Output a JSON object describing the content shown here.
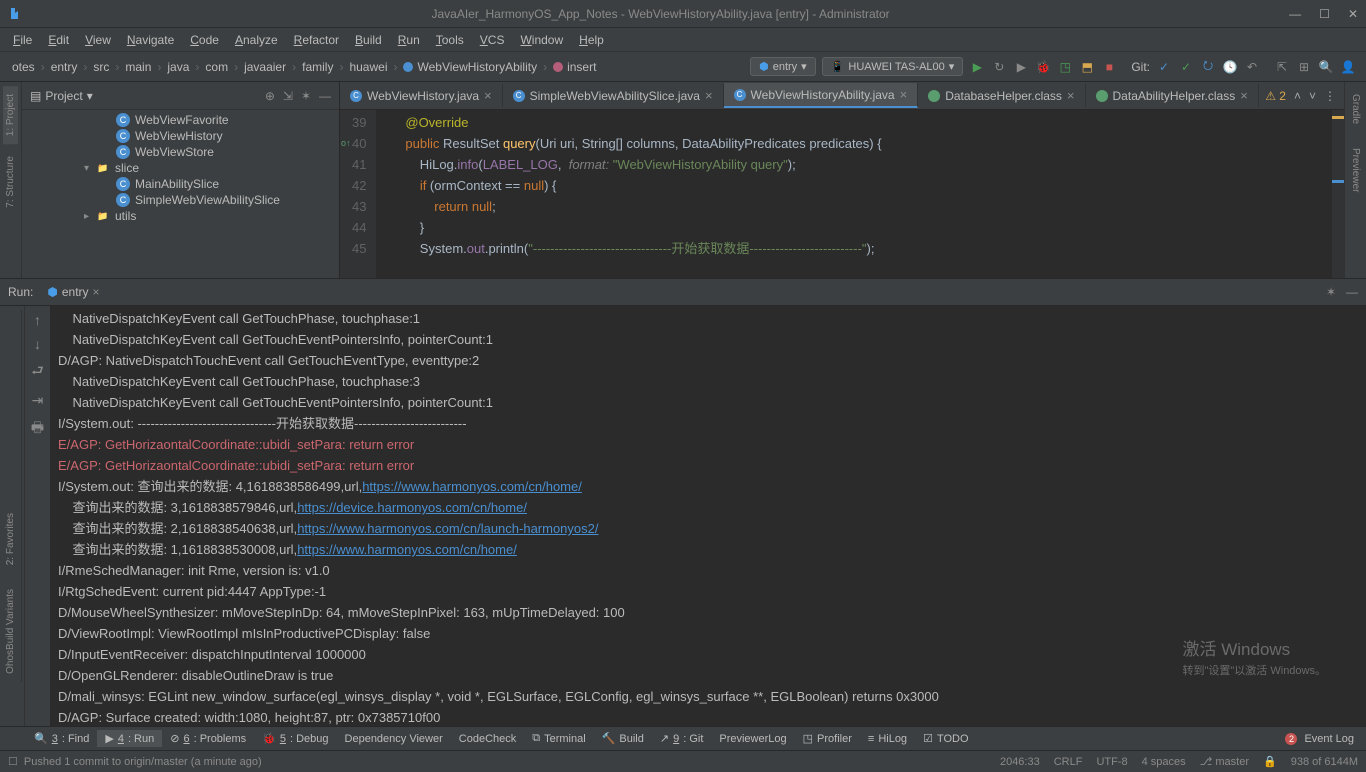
{
  "window": {
    "title": "JavaAIer_HarmonyOS_App_Notes - WebViewHistoryAbility.java [entry] - Administrator"
  },
  "menu": [
    "File",
    "Edit",
    "View",
    "Navigate",
    "Code",
    "Analyze",
    "Refactor",
    "Build",
    "Run",
    "Tools",
    "VCS",
    "Window",
    "Help"
  ],
  "breadcrumb": [
    "otes",
    "entry",
    "src",
    "main",
    "java",
    "com",
    "javaaier",
    "family",
    "huawei",
    "WebViewHistoryAbility",
    "insert"
  ],
  "toolbar": {
    "run_config": "entry",
    "device": "HUAWEI TAS-AL00",
    "git_label": "Git:"
  },
  "left_tabs": {
    "project": "1: Project",
    "structure": "7: Structure",
    "favorites": "2: Favorites",
    "build": "OhosBuild Variants"
  },
  "right_tabs": {
    "gradle": "Gradle",
    "previewer": "Previewer"
  },
  "project": {
    "header": "Project",
    "items": [
      {
        "indent": 90,
        "icon": "c",
        "label": "WebViewFavorite"
      },
      {
        "indent": 90,
        "icon": "c",
        "label": "WebViewHistory"
      },
      {
        "indent": 90,
        "icon": "c",
        "label": "WebViewStore"
      },
      {
        "indent": 58,
        "arrow": "▾",
        "icon": "folder",
        "label": "slice"
      },
      {
        "indent": 90,
        "icon": "c",
        "label": "MainAbilitySlice"
      },
      {
        "indent": 90,
        "icon": "c",
        "label": "SimpleWebViewAbilitySlice"
      },
      {
        "indent": 58,
        "arrow": "▸",
        "icon": "folder",
        "label": "utils"
      }
    ]
  },
  "editor_tabs": [
    {
      "icon": "c",
      "label": "WebViewHistory.java",
      "active": false
    },
    {
      "icon": "c",
      "label": "SimpleWebViewAbilitySlice.java",
      "active": false
    },
    {
      "icon": "c",
      "label": "WebViewHistoryAbility.java",
      "active": true
    },
    {
      "icon": "db",
      "label": "DatabaseHelper.class",
      "active": false
    },
    {
      "icon": "db",
      "label": "DataAbilityHelper.class",
      "active": false
    }
  ],
  "editor": {
    "warn_count": "2",
    "lines": [
      {
        "n": 39,
        "html": "        <span class='anno'>@Override</span>"
      },
      {
        "n": 40,
        "override": true,
        "html": "        <span class='kw'>public</span> <span class='cls'>ResultSet</span> <span class='mtd'>query</span>(Uri uri, String[] columns, DataAbilityPredicates predicates) {"
      },
      {
        "n": 41,
        "html": "            HiLog.<span class='fld'>info</span>(<span class='fld'>LABEL_LOG</span>,  <span class='com'>format:</span> <span class='str'>\"WebViewHistoryAbility query\"</span>);"
      },
      {
        "n": 42,
        "html": "            <span class='kw'>if</span> (ormContext == <span class='kw'>null</span>) {"
      },
      {
        "n": 43,
        "html": "                <span class='kw'>return null</span>;"
      },
      {
        "n": 44,
        "html": "            }"
      },
      {
        "n": 45,
        "html": "            System.<span class='fld'>out</span>.println(<span class='str'>\"--------------------------------开始获取数据--------------------------\"</span>);"
      }
    ]
  },
  "run": {
    "label": "Run:",
    "tab": "entry",
    "console_lines": [
      {
        "cls": "",
        "html": "    NativeDispatchKeyEvent call GetTouchPhase, touchphase:1"
      },
      {
        "cls": "",
        "html": "    NativeDispatchKeyEvent call GetTouchEventPointersInfo, pointerCount:1"
      },
      {
        "cls": "",
        "html": "D/AGP: NativeDispatchTouchEvent call GetTouchEventType, eventtype:2"
      },
      {
        "cls": "",
        "html": "    NativeDispatchKeyEvent call GetTouchPhase, touchphase:3"
      },
      {
        "cls": "",
        "html": "    NativeDispatchKeyEvent call GetTouchEventPointersInfo, pointerCount:1"
      },
      {
        "cls": "",
        "html": "I/System.out: --------------------------------开始获取数据--------------------------"
      },
      {
        "cls": "err",
        "html": "E/AGP: GetHorizaontalCoordinate::ubidi_setPara: return error"
      },
      {
        "cls": "err",
        "html": "E/AGP: GetHorizaontalCoordinate::ubidi_setPara: return error"
      },
      {
        "cls": "",
        "html": "I/System.out: 查询出来的数据: 4,1618838586499,url,<a href='#'>https://www.harmonyos.com/cn/home/</a>"
      },
      {
        "cls": "",
        "html": "    查询出来的数据: 3,1618838579846,url,<a href='#'>https://device.harmonyos.com/cn/home/</a>"
      },
      {
        "cls": "",
        "html": "    查询出来的数据: 2,1618838540638,url,<a href='#'>https://www.harmonyos.com/cn/launch-harmonyos2/</a>"
      },
      {
        "cls": "",
        "html": "    查询出来的数据: 1,1618838530008,url,<a href='#'>https://www.harmonyos.com/cn/home/</a>"
      },
      {
        "cls": "",
        "html": "I/RmeSchedManager: init Rme, version is: v1.0"
      },
      {
        "cls": "",
        "html": "I/RtgSchedEvent: current pid:4447 AppType:-1"
      },
      {
        "cls": "",
        "html": "D/MouseWheelSynthesizer: mMoveStepInDp: 64, mMoveStepInPixel: 163, mUpTimeDelayed: 100"
      },
      {
        "cls": "",
        "html": "D/ViewRootImpl: ViewRootImpl mIsInProductivePCDisplay: false"
      },
      {
        "cls": "",
        "html": "D/InputEventReceiver: dispatchInputInterval 1000000"
      },
      {
        "cls": "",
        "html": "D/OpenGLRenderer: disableOutlineDraw is true"
      },
      {
        "cls": "",
        "html": "D/mali_winsys: EGLint new_window_surface(egl_winsys_display *, void *, EGLSurface, EGLConfig, egl_winsys_surface **, EGLBoolean) returns 0x3000"
      },
      {
        "cls": "",
        "html": "D/AGP: Surface created: width:1080, height:87, ptr: 0x7385710f00"
      }
    ]
  },
  "bottom_tabs": [
    {
      "icon": "🔍",
      "num": "3",
      "label": ": Find"
    },
    {
      "icon": "▶",
      "num": "4",
      "label": ": Run",
      "active": true
    },
    {
      "icon": "⊘",
      "num": "6",
      "label": ": Problems"
    },
    {
      "icon": "🐞",
      "num": "5",
      "label": ": Debug"
    },
    {
      "icon": "",
      "num": "",
      "label": "Dependency Viewer"
    },
    {
      "icon": "",
      "num": "",
      "label": "CodeCheck"
    },
    {
      "icon": "⧉",
      "num": "",
      "label": "Terminal"
    },
    {
      "icon": "🔨",
      "num": "",
      "label": "Build"
    },
    {
      "icon": "↗",
      "num": "9",
      "label": ": Git"
    },
    {
      "icon": "",
      "num": "",
      "label": "PreviewerLog"
    },
    {
      "icon": "◳",
      "num": "",
      "label": "Profiler"
    },
    {
      "icon": "≡",
      "num": "",
      "label": "HiLog"
    },
    {
      "icon": "☑",
      "num": "",
      "label": "TODO"
    }
  ],
  "event_log": "Event Log",
  "event_badge": "2",
  "status": {
    "message": "Pushed 1 commit to origin/master (a minute ago)",
    "pos": "2046:33",
    "crlf": "CRLF",
    "encoding": "UTF-8",
    "indent": "4 spaces",
    "branch": "master",
    "mem": "938 of 6144M"
  },
  "watermark": {
    "l1": "激活 Windows",
    "l2": "转到\"设置\"以激活 Windows。"
  }
}
